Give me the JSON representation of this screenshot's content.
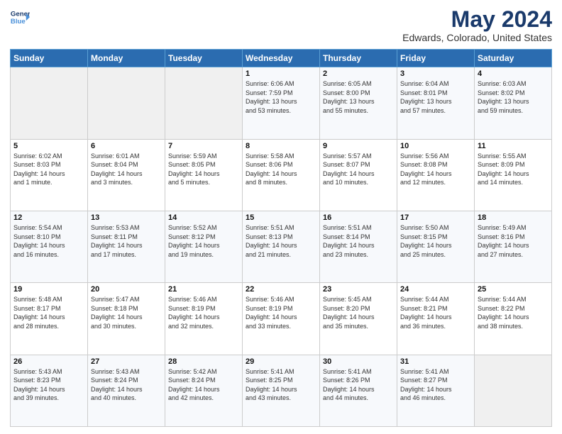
{
  "logo": {
    "line1": "General",
    "line2": "Blue",
    "arrow_color": "#4a90d9"
  },
  "header": {
    "title": "May 2024",
    "subtitle": "Edwards, Colorado, United States"
  },
  "weekdays": [
    "Sunday",
    "Monday",
    "Tuesday",
    "Wednesday",
    "Thursday",
    "Friday",
    "Saturday"
  ],
  "weeks": [
    [
      {
        "day": "",
        "info": ""
      },
      {
        "day": "",
        "info": ""
      },
      {
        "day": "",
        "info": ""
      },
      {
        "day": "1",
        "info": "Sunrise: 6:06 AM\nSunset: 7:59 PM\nDaylight: 13 hours\nand 53 minutes."
      },
      {
        "day": "2",
        "info": "Sunrise: 6:05 AM\nSunset: 8:00 PM\nDaylight: 13 hours\nand 55 minutes."
      },
      {
        "day": "3",
        "info": "Sunrise: 6:04 AM\nSunset: 8:01 PM\nDaylight: 13 hours\nand 57 minutes."
      },
      {
        "day": "4",
        "info": "Sunrise: 6:03 AM\nSunset: 8:02 PM\nDaylight: 13 hours\nand 59 minutes."
      }
    ],
    [
      {
        "day": "5",
        "info": "Sunrise: 6:02 AM\nSunset: 8:03 PM\nDaylight: 14 hours\nand 1 minute."
      },
      {
        "day": "6",
        "info": "Sunrise: 6:01 AM\nSunset: 8:04 PM\nDaylight: 14 hours\nand 3 minutes."
      },
      {
        "day": "7",
        "info": "Sunrise: 5:59 AM\nSunset: 8:05 PM\nDaylight: 14 hours\nand 5 minutes."
      },
      {
        "day": "8",
        "info": "Sunrise: 5:58 AM\nSunset: 8:06 PM\nDaylight: 14 hours\nand 8 minutes."
      },
      {
        "day": "9",
        "info": "Sunrise: 5:57 AM\nSunset: 8:07 PM\nDaylight: 14 hours\nand 10 minutes."
      },
      {
        "day": "10",
        "info": "Sunrise: 5:56 AM\nSunset: 8:08 PM\nDaylight: 14 hours\nand 12 minutes."
      },
      {
        "day": "11",
        "info": "Sunrise: 5:55 AM\nSunset: 8:09 PM\nDaylight: 14 hours\nand 14 minutes."
      }
    ],
    [
      {
        "day": "12",
        "info": "Sunrise: 5:54 AM\nSunset: 8:10 PM\nDaylight: 14 hours\nand 16 minutes."
      },
      {
        "day": "13",
        "info": "Sunrise: 5:53 AM\nSunset: 8:11 PM\nDaylight: 14 hours\nand 17 minutes."
      },
      {
        "day": "14",
        "info": "Sunrise: 5:52 AM\nSunset: 8:12 PM\nDaylight: 14 hours\nand 19 minutes."
      },
      {
        "day": "15",
        "info": "Sunrise: 5:51 AM\nSunset: 8:13 PM\nDaylight: 14 hours\nand 21 minutes."
      },
      {
        "day": "16",
        "info": "Sunrise: 5:51 AM\nSunset: 8:14 PM\nDaylight: 14 hours\nand 23 minutes."
      },
      {
        "day": "17",
        "info": "Sunrise: 5:50 AM\nSunset: 8:15 PM\nDaylight: 14 hours\nand 25 minutes."
      },
      {
        "day": "18",
        "info": "Sunrise: 5:49 AM\nSunset: 8:16 PM\nDaylight: 14 hours\nand 27 minutes."
      }
    ],
    [
      {
        "day": "19",
        "info": "Sunrise: 5:48 AM\nSunset: 8:17 PM\nDaylight: 14 hours\nand 28 minutes."
      },
      {
        "day": "20",
        "info": "Sunrise: 5:47 AM\nSunset: 8:18 PM\nDaylight: 14 hours\nand 30 minutes."
      },
      {
        "day": "21",
        "info": "Sunrise: 5:46 AM\nSunset: 8:19 PM\nDaylight: 14 hours\nand 32 minutes."
      },
      {
        "day": "22",
        "info": "Sunrise: 5:46 AM\nSunset: 8:19 PM\nDaylight: 14 hours\nand 33 minutes."
      },
      {
        "day": "23",
        "info": "Sunrise: 5:45 AM\nSunset: 8:20 PM\nDaylight: 14 hours\nand 35 minutes."
      },
      {
        "day": "24",
        "info": "Sunrise: 5:44 AM\nSunset: 8:21 PM\nDaylight: 14 hours\nand 36 minutes."
      },
      {
        "day": "25",
        "info": "Sunrise: 5:44 AM\nSunset: 8:22 PM\nDaylight: 14 hours\nand 38 minutes."
      }
    ],
    [
      {
        "day": "26",
        "info": "Sunrise: 5:43 AM\nSunset: 8:23 PM\nDaylight: 14 hours\nand 39 minutes."
      },
      {
        "day": "27",
        "info": "Sunrise: 5:43 AM\nSunset: 8:24 PM\nDaylight: 14 hours\nand 40 minutes."
      },
      {
        "day": "28",
        "info": "Sunrise: 5:42 AM\nSunset: 8:24 PM\nDaylight: 14 hours\nand 42 minutes."
      },
      {
        "day": "29",
        "info": "Sunrise: 5:41 AM\nSunset: 8:25 PM\nDaylight: 14 hours\nand 43 minutes."
      },
      {
        "day": "30",
        "info": "Sunrise: 5:41 AM\nSunset: 8:26 PM\nDaylight: 14 hours\nand 44 minutes."
      },
      {
        "day": "31",
        "info": "Sunrise: 5:41 AM\nSunset: 8:27 PM\nDaylight: 14 hours\nand 46 minutes."
      },
      {
        "day": "",
        "info": ""
      }
    ]
  ]
}
